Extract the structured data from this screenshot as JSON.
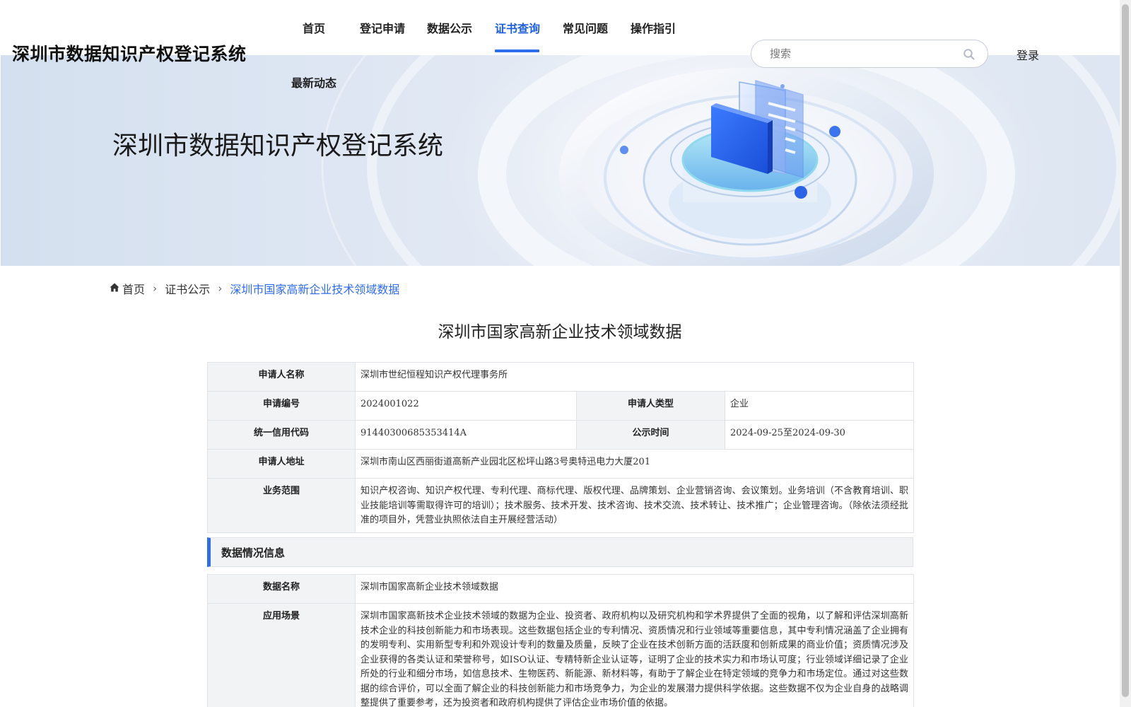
{
  "header": {
    "site_title": "深圳市数据知识产权登记系统",
    "nav": [
      {
        "label": "首页"
      },
      {
        "label": "登记申请"
      },
      {
        "label": "数据公示"
      },
      {
        "label": "证书查询"
      },
      {
        "label": "常见问题"
      },
      {
        "label": "操作指引"
      }
    ],
    "nav_second_row": "最新动态",
    "active_nav": "证书查询",
    "search_placeholder": "搜索",
    "search_icon": "search-icon",
    "login_label": "登录",
    "accent_color": "#2f6df0"
  },
  "banner": {
    "title": "深圳市数据知识产权登记系统"
  },
  "breadcrumb": {
    "home_icon": "home-icon",
    "items": [
      "首页",
      "证书公示",
      "深圳市国家高新企业技术领域数据"
    ]
  },
  "page_title": "深圳市国家高新企业技术领域数据",
  "applicant": {
    "name_label": "申请人名称",
    "name": "深圳市世纪恒程知识产权代理事务所",
    "number_label": "申请编号",
    "number": "2024001022",
    "type_label": "申请人类型",
    "type": "企业",
    "credit_code_label": "统一信用代码",
    "credit_code": "91440300685353414A",
    "publicity_time_label": "公示时间",
    "publicity_time": "2024-09-25至2024-09-30",
    "address_label": "申请人地址",
    "address": "深圳市南山区西丽街道高新产业园北区松坪山路3号奥特迅电力大厦201",
    "scope_label": "业务范围",
    "scope": "知识产权咨询、知识产权代理、专利代理、商标代理、版权代理、品牌策划、企业营销咨询、会议策划。业务培训（不含教育培训、职业技能培训等需取得许可的培训）；技术服务、技术开发、技术咨询、技术交流、技术转让、技术推广；企业管理咨询。（除依法须经批准的项目外，凭营业执照依法自主开展经营活动）"
  },
  "data_section": {
    "heading": "数据情况信息",
    "name_label": "数据名称",
    "name": "深圳市国家高新企业技术领域数据",
    "scenario_label": "应用场景",
    "scenario": "深圳市国家高新技术企业技术领域的数据为企业、投资者、政府机构以及研究机构和学术界提供了全面的视角，以了解和评估深圳高新技术企业的科技创新能力和市场表现。这些数据包括企业的专利情况、资质情况和行业领域等重要信息，其中专利情况涵盖了企业拥有的发明专利、实用新型专利和外观设计专利的数量及质量，反映了企业在技术创新方面的活跃度和创新成果的商业价值；资质情况涉及企业获得的各类认证和荣誉称号，如ISO认证、专精特新企业认证等，证明了企业的技术实力和市场认可度；行业领域详细记录了企业所处的行业和细分市场，如信息技术、生物医药、新能源、新材料等，有助于了解企业在特定领域的竞争力和市场定位。通过对这些数据的综合评价，可以全面了解企业的科技创新能力和市场竞争力，为企业的发展潜力提供科学依据。这些数据不仅为企业自身的战略调整提供了重要参考，还为投资者和政府机构提供了评估企业市场价值的依据。"
  }
}
